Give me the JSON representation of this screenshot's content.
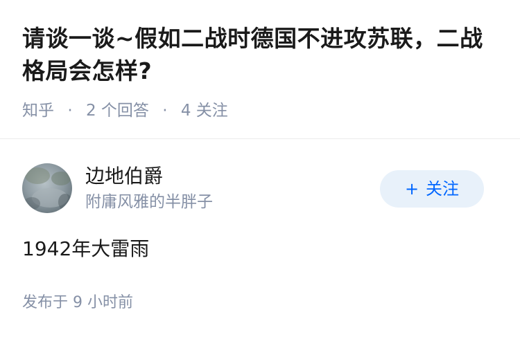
{
  "question": {
    "title": "请谈一谈~假如二战时德国不进攻苏联，二战格局会怎样?",
    "source": "知乎",
    "separator": "·",
    "answers_count": "2 个回答",
    "followers_count": "4 关注"
  },
  "answer": {
    "author_name": "边地伯爵",
    "author_bio": "附庸风雅的半胖子",
    "follow_button_plus": "+",
    "follow_button_label": "关注",
    "content": "1942年大雷雨",
    "published": "发布于 9 小时前"
  },
  "colors": {
    "accent": "#0066ff",
    "button_bg": "#e8f1fa",
    "meta_text": "#8590a6",
    "primary_text": "#1a1a1a",
    "divider": "#ebebeb"
  },
  "icons": {
    "avatar": "user-avatar-photo"
  }
}
